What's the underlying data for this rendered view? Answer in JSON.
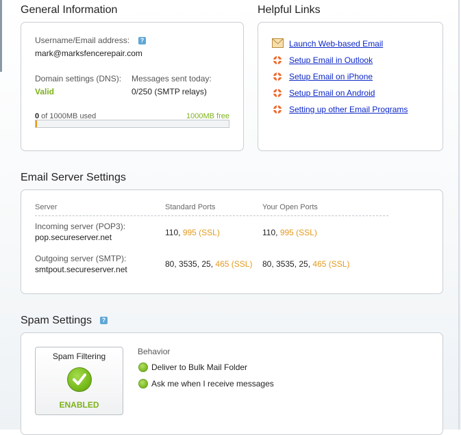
{
  "general": {
    "title": "General Information",
    "username_label": "Username/Email address:",
    "username_value": "mark@marksfencerepair.com",
    "dns_label": "Domain settings (DNS):",
    "dns_value": "Valid",
    "messages_label": "Messages sent today:",
    "messages_value": "0/250 (SMTP relays)",
    "usage_used": "0",
    "usage_of": " of 1000MB used",
    "usage_free": "1000MB free",
    "usage_fraction": 0.0
  },
  "helpful_links": {
    "title": "Helpful Links",
    "items": [
      {
        "label": "Launch Web-based Email",
        "icon": "envelope-icon"
      },
      {
        "label": "Setup Email in Outlook",
        "icon": "lifering-icon"
      },
      {
        "label": "Setup Email on iPhone",
        "icon": "lifering-icon"
      },
      {
        "label": "Setup Email on Android",
        "icon": "lifering-icon"
      },
      {
        "label": "Setting up other Email Programs",
        "icon": "lifering-icon"
      }
    ]
  },
  "server": {
    "title": "Email Server Settings",
    "columns": [
      "Server",
      "Standard Ports",
      "Your Open Ports"
    ],
    "rows": [
      {
        "label": "Incoming server (POP3):",
        "host": "pop.secureserver.net",
        "std_plain": "110, ",
        "std_ssl": "995 (SSL)",
        "open_plain": "110, ",
        "open_ssl": "995 (SSL)"
      },
      {
        "label": "Outgoing server (SMTP):",
        "host": "smtpout.secureserver.net",
        "std_plain": "80, 3535, 25, ",
        "std_ssl": "465 (SSL)",
        "open_plain": "80, 3535, 25, ",
        "open_ssl": "465 (SSL)"
      }
    ]
  },
  "spam": {
    "title": "Spam Settings",
    "card_title": "Spam Filtering",
    "status": "ENABLED",
    "behavior_label": "Behavior",
    "options": [
      "Deliver to Bulk Mail Folder",
      "Ask me when I receive messages"
    ]
  },
  "colors": {
    "link": "#0b27c8",
    "valid_green": "#7db21a",
    "ssl_orange": "#e39a1e",
    "help_blue": "#5fa7d6"
  }
}
